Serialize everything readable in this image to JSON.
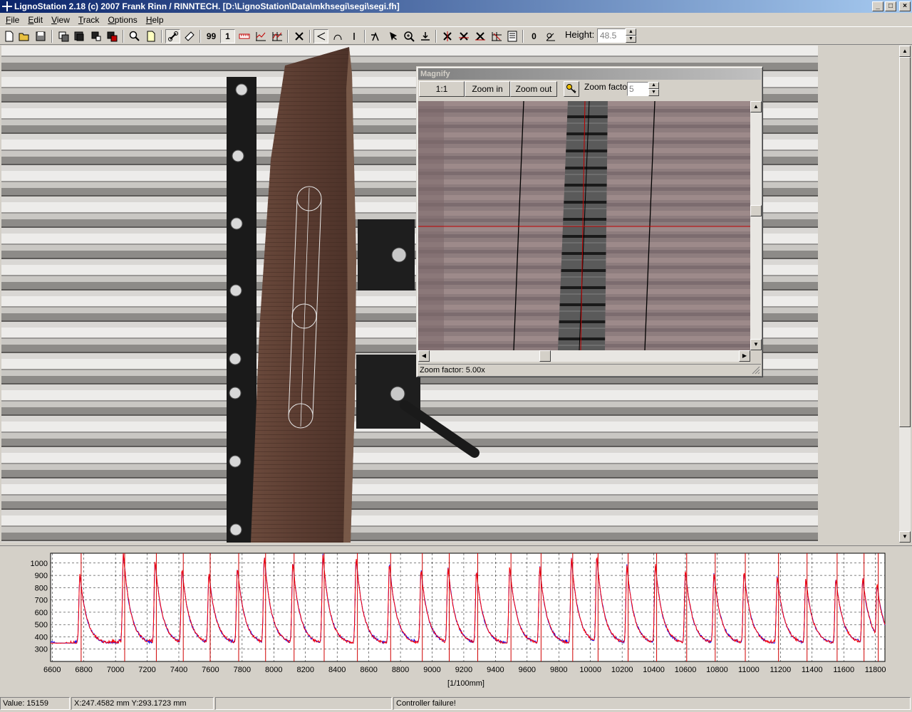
{
  "window": {
    "title": "LignoStation 2.18 (c) 2007 Frank Rinn / RINNTECH.  [D:\\LignoStation\\Data\\mkhsegi\\segi\\segi.fh]",
    "minimize": "_",
    "maximize": "□",
    "close": "×"
  },
  "menu": [
    "File",
    "Edit",
    "View",
    "Track",
    "Options",
    "Help"
  ],
  "toolbar": {
    "label_99": "99",
    "label_1": "1",
    "label_0": "0",
    "height_label": "Height:",
    "height_value": "48.5"
  },
  "magnify": {
    "title": "Magnify",
    "btn_1to1": "1:1",
    "btn_zoom_in": "Zoom in",
    "btn_zoom_out": "Zoom out",
    "zoom_factor_label": "Zoom factor:",
    "zoom_factor_value": "5",
    "status": "Zoom factor: 5.00x"
  },
  "chart_data": {
    "type": "line",
    "title": "",
    "xlabel": "[1/100mm]",
    "ylabel": "",
    "xlim": [
      6590,
      11860
    ],
    "ylim": [
      200,
      1080
    ],
    "x_ticks": [
      6600,
      6800,
      7000,
      7200,
      7400,
      7600,
      7800,
      8000,
      8200,
      8400,
      8600,
      8800,
      9000,
      9200,
      9400,
      9600,
      9800,
      10000,
      10200,
      10400,
      10600,
      10800,
      11000,
      11200,
      11400,
      11600,
      11800
    ],
    "y_ticks": [
      300,
      400,
      500,
      600,
      700,
      800,
      900,
      1000
    ],
    "grid": true,
    "series": [
      {
        "color": "#0000ff"
      },
      {
        "color": "#ff0000"
      }
    ],
    "peaks": [
      {
        "x": 6775,
        "y": 910
      },
      {
        "x": 7050,
        "y": 1080
      },
      {
        "x": 7250,
        "y": 1020
      },
      {
        "x": 7420,
        "y": 960
      },
      {
        "x": 7590,
        "y": 920
      },
      {
        "x": 7770,
        "y": 970
      },
      {
        "x": 7940,
        "y": 1060
      },
      {
        "x": 8120,
        "y": 1010
      },
      {
        "x": 8310,
        "y": 1070
      },
      {
        "x": 8520,
        "y": 1050
      },
      {
        "x": 8730,
        "y": 1000
      },
      {
        "x": 8930,
        "y": 950
      },
      {
        "x": 9100,
        "y": 980
      },
      {
        "x": 9280,
        "y": 940
      },
      {
        "x": 9490,
        "y": 980
      },
      {
        "x": 9680,
        "y": 970
      },
      {
        "x": 9880,
        "y": 1040
      },
      {
        "x": 10040,
        "y": 1060
      },
      {
        "x": 10230,
        "y": 990
      },
      {
        "x": 10410,
        "y": 1000
      },
      {
        "x": 10600,
        "y": 940
      },
      {
        "x": 10780,
        "y": 920
      },
      {
        "x": 10970,
        "y": 940
      },
      {
        "x": 11180,
        "y": 900
      },
      {
        "x": 11360,
        "y": 880
      },
      {
        "x": 11550,
        "y": 880
      },
      {
        "x": 11720,
        "y": 880
      },
      {
        "x": 11810,
        "y": 830
      }
    ],
    "baseline": 340
  },
  "status": {
    "value": "Value: 15159",
    "coords": "X:247.4582 mm  Y:293.1723 mm",
    "message": "Controller failure!"
  }
}
